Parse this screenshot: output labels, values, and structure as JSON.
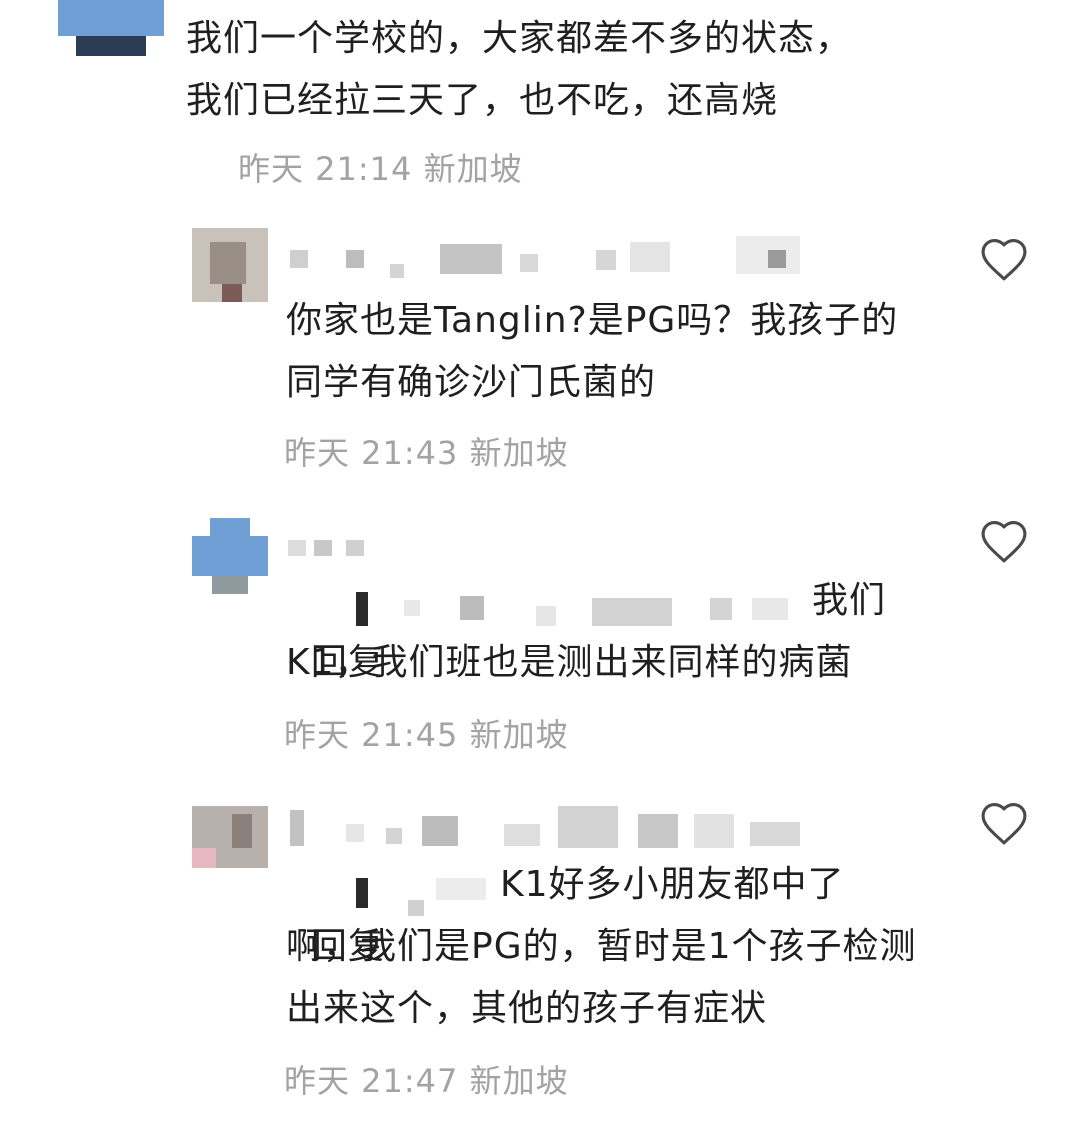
{
  "comments": [
    {
      "text": "我们一个学校的，大家都差不多的状态，我们已经拉三天了，也不吃，还高烧",
      "time": "昨天 21:14",
      "location": "新加坡"
    }
  ],
  "replies": [
    {
      "text": "你家也是Tanglin?是PG吗？我孩子的同学有确诊沙门氏菌的",
      "time": "昨天 21:43",
      "location": "新加坡",
      "icon": "heart-outline-icon"
    },
    {
      "reply_prefix": "回复",
      "text_tail": "我们",
      "text": "K1，我们班也是测出来同样的病菌",
      "time": "昨天 21:45",
      "location": "新加坡",
      "icon": "heart-outline-icon"
    },
    {
      "reply_prefix": "回复",
      "text_tail": "K1好多小朋友都中了",
      "text": "啊，我们是PG的，暂时是1个孩子检测出来这个，其他的孩子有症状",
      "time": "昨天 21:47",
      "location": "新加坡",
      "icon": "heart-outline-icon"
    }
  ],
  "colors": {
    "text": "#1f1f1f",
    "meta": "#a3a3a3",
    "heart": "#4a4a4a",
    "avatar_blue": "#6f9fd4"
  }
}
